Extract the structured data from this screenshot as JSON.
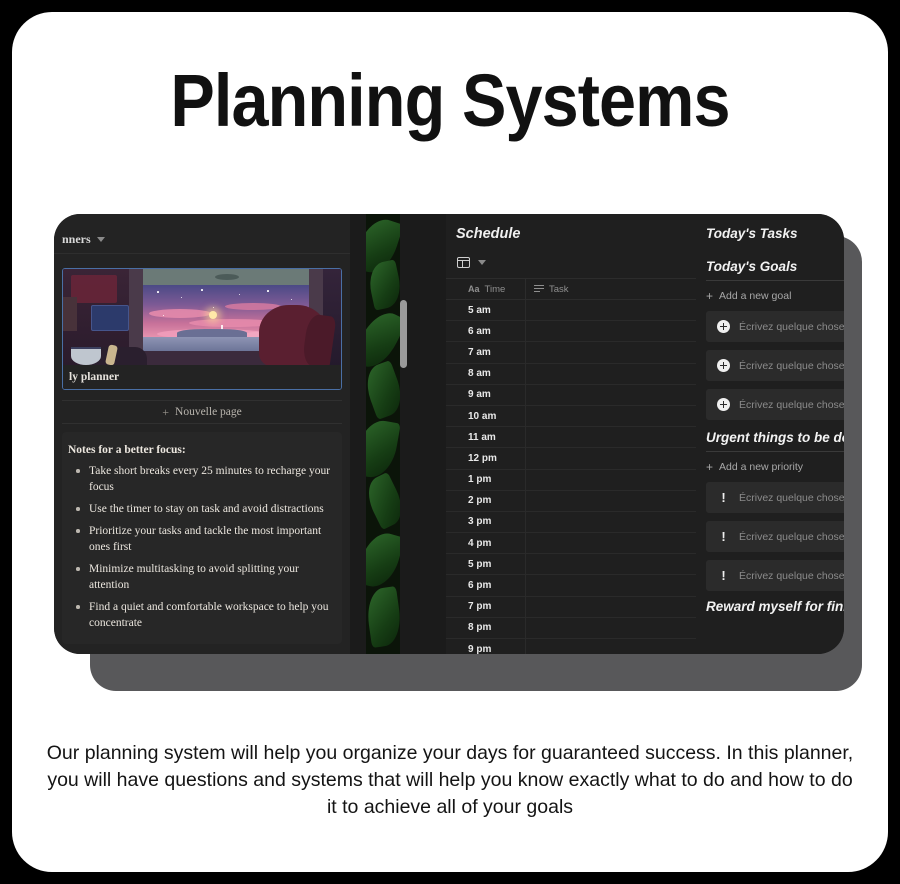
{
  "title": "Planning Systems",
  "caption": "Our planning system will help you organize your days for guaranteed success. In this planner, you will have questions and systems that will help you know exactly what to do and how to do it to achieve all of your goals",
  "colors": {
    "outer_background": "#000000",
    "card_background": "#ffffff",
    "app_panel": "#1f1f1f",
    "shadow_layer": "#58585a",
    "card_accent_border": "#4a6fa5",
    "text_primary": "#f0f0f0",
    "text_muted": "#8b8b8b"
  },
  "app": {
    "left_pane": {
      "breadcrumb": "nners",
      "breadcrumb_icon": "chevron-down-icon",
      "planner_card_label": "ly planner",
      "new_page_label": "Nouvelle page",
      "new_page_icon": "plus-icon",
      "notes_title": "Notes for a better focus:",
      "notes": [
        "Take short breaks every 25 minutes to recharge your focus",
        "Use the timer to stay on task and avoid distractions",
        "Prioritize your tasks and tackle the most important ones first",
        "Minimize multitasking to avoid splitting your attention",
        "Find a quiet and comfortable workspace to help you concentrate"
      ]
    },
    "schedule": {
      "title": "Schedule",
      "view_icon": "table-icon",
      "view_chevron_icon": "chevron-down-icon",
      "columns": [
        {
          "label": "Time",
          "icon": "aa-text-icon"
        },
        {
          "label": "Task",
          "icon": "text-lines-icon"
        }
      ],
      "rows": [
        {
          "time": "5 am",
          "task": ""
        },
        {
          "time": "6 am",
          "task": ""
        },
        {
          "time": "7 am",
          "task": ""
        },
        {
          "time": "8 am",
          "task": ""
        },
        {
          "time": "9 am",
          "task": ""
        },
        {
          "time": "10 am",
          "task": ""
        },
        {
          "time": "11 am",
          "task": ""
        },
        {
          "time": "12 pm",
          "task": ""
        },
        {
          "time": "1 pm",
          "task": ""
        },
        {
          "time": "2 pm",
          "task": ""
        },
        {
          "time": "3 pm",
          "task": ""
        },
        {
          "time": "4 pm",
          "task": ""
        },
        {
          "time": "5 pm",
          "task": ""
        },
        {
          "time": "6 pm",
          "task": ""
        },
        {
          "time": "7 pm",
          "task": ""
        },
        {
          "time": "8 pm",
          "task": ""
        },
        {
          "time": "9 pm",
          "task": ""
        }
      ]
    },
    "right_pane": {
      "tasks_heading": "Today's Tasks",
      "goals_heading": "Today's Goals",
      "add_goal_label": "Add a new goal",
      "goal_entries": [
        {
          "icon": "plus-circle-icon",
          "placeholder": "Écrivez quelque chose..."
        },
        {
          "icon": "plus-circle-icon",
          "placeholder": "Écrivez quelque chose..."
        },
        {
          "icon": "plus-circle-icon",
          "placeholder": "Écrivez quelque chose..."
        }
      ],
      "urgent_heading": "Urgent things to be done tod",
      "add_priority_label": "Add a new priority",
      "priority_entries": [
        {
          "icon": "exclamation-icon",
          "placeholder": "Écrivez quelque chose..."
        },
        {
          "icon": "exclamation-icon",
          "placeholder": "Écrivez quelque chose..."
        },
        {
          "icon": "exclamation-icon",
          "placeholder": "Écrivez quelque chose..."
        }
      ],
      "reward_heading": "Reward myself for finishing"
    }
  }
}
